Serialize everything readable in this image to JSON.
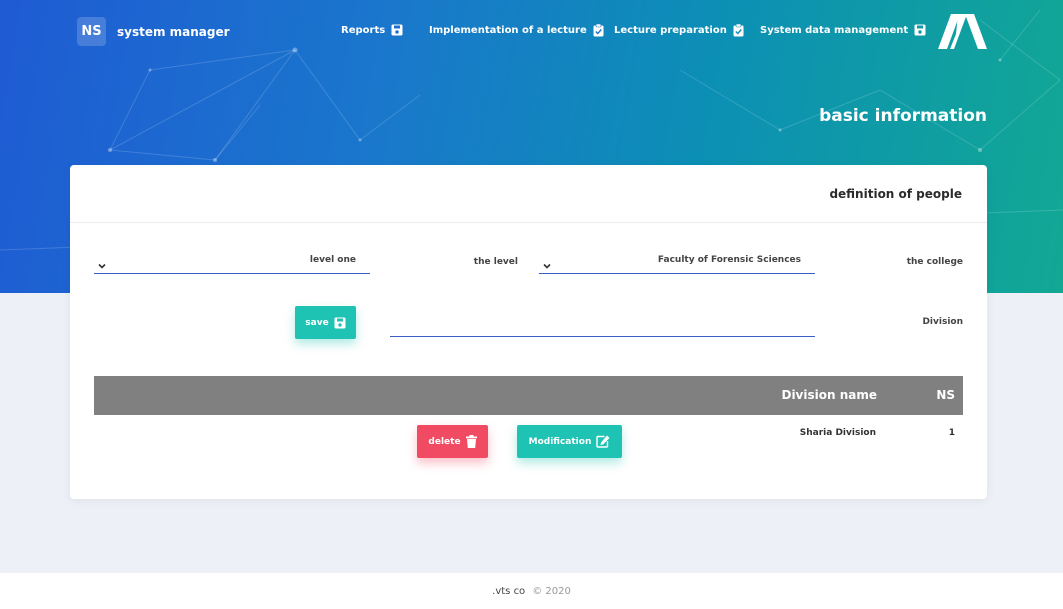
{
  "header": {
    "brand_badge": "NS",
    "brand_name": "system manager",
    "nav": [
      {
        "label": "Reports",
        "icon": "save-icon"
      },
      {
        "label": "Implementation of a lecture",
        "icon": "clipboard-check-icon"
      },
      {
        "label": "Lecture preparation",
        "icon": "clipboard-check-icon"
      },
      {
        "label": "System data management",
        "icon": "save-icon"
      }
    ],
    "page_title": "basic information"
  },
  "card": {
    "title": "definition of people",
    "college_label": "the college",
    "college_value": "Faculty of Forensic Sciences",
    "level_label": "the level",
    "level_value": "level one",
    "division_label": "Division",
    "division_value": "",
    "save_label": "save"
  },
  "table": {
    "headers": {
      "ns": "NS",
      "division_name": "Division name"
    },
    "rows": [
      {
        "ns": "1",
        "division_name": "Sharia Division",
        "modify_label": "Modification",
        "delete_label": "delete"
      }
    ]
  },
  "footer": {
    "company": ".vts co",
    "copyright": "© 2020"
  },
  "colors": {
    "hero_start": "#1f5bd4",
    "hero_end": "#12a894",
    "accent": "#1fc3b3",
    "danger": "#f04b62",
    "table_header": "#808080",
    "input_underline": "#3b5fc0"
  }
}
